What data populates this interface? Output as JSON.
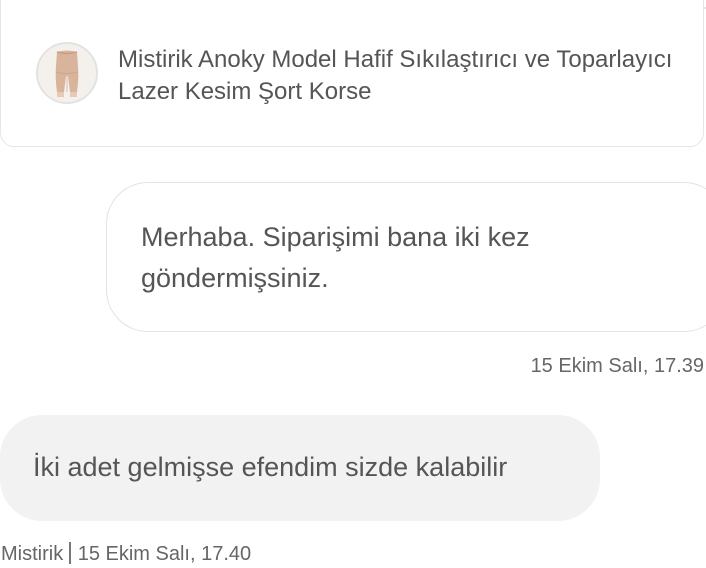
{
  "product": {
    "thumbnail_icon": "shapewear-product-thumbnail",
    "title": "Mistirik Anoky Model Hafif Sıkılaştırıcı ve Toparlayıcı Lazer Kesim Şort Korse"
  },
  "messages": [
    {
      "direction": "outgoing",
      "text": "Merhaba. Siparişimi bana iki kez göndermişsiniz.",
      "timestamp": "15 Ekim Salı, 17.39"
    },
    {
      "direction": "incoming",
      "text": "İki adet gelmişse efendim sizde kalabilir",
      "sender": "Mistirik",
      "timestamp": "15 Ekim Salı, 17.40"
    }
  ],
  "colors": {
    "text": "#555555",
    "meta_text": "#666666",
    "border": "#e3e3e3",
    "incoming_bubble": "#f2f2f2"
  }
}
